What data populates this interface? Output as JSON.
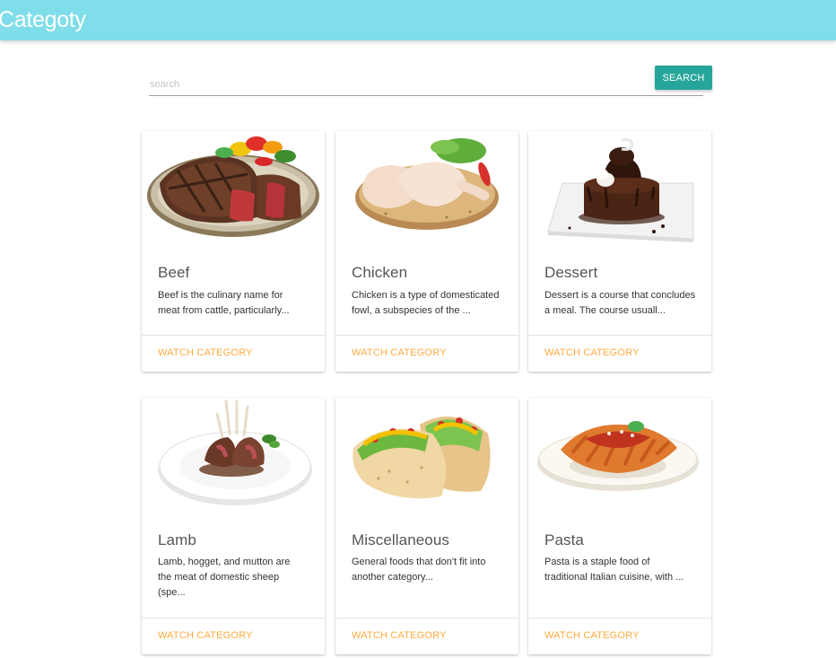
{
  "header": {
    "title": "Categoty",
    "color": "#80deea"
  },
  "search": {
    "placeholder": "search",
    "value": "",
    "button_label": "SEARCH",
    "button_color": "#26a69a"
  },
  "categories": [
    {
      "name": "Beef",
      "description_line1": "Beef is the culinary name for",
      "description_line2": "meat from cattle, particularly...",
      "description_line3": "",
      "action": "WATCH CATEGORY",
      "image_icon": "beef-steak-image"
    },
    {
      "name": "Chicken",
      "description_line1": "Chicken is a type of domesticated",
      "description_line2": "fowl, a subspecies of the ...",
      "description_line3": "",
      "action": "WATCH CATEGORY",
      "image_icon": "chicken-legs-image"
    },
    {
      "name": "Dessert",
      "description_line1": "Dessert is a course that concludes",
      "description_line2": "a meal. The course usuall...",
      "description_line3": "",
      "action": "WATCH CATEGORY",
      "image_icon": "chocolate-cake-image"
    },
    {
      "name": "Lamb",
      "description_line1": "Lamb, hogget, and mutton are",
      "description_line2": "the meat of domestic sheep",
      "description_line3": "(spe...",
      "action": "WATCH CATEGORY",
      "image_icon": "lamb-chops-image"
    },
    {
      "name": "Miscellaneous",
      "description_line1": "General foods that don't fit into",
      "description_line2": "another category...",
      "description_line3": "",
      "action": "WATCH CATEGORY",
      "image_icon": "tacos-image"
    },
    {
      "name": "Pasta",
      "description_line1": "Pasta is a staple food of",
      "description_line2": "traditional Italian cuisine, with ...",
      "description_line3": "",
      "action": "WATCH CATEGORY",
      "image_icon": "pasta-plate-image"
    }
  ],
  "colors": {
    "action_link": "#ffab40"
  }
}
